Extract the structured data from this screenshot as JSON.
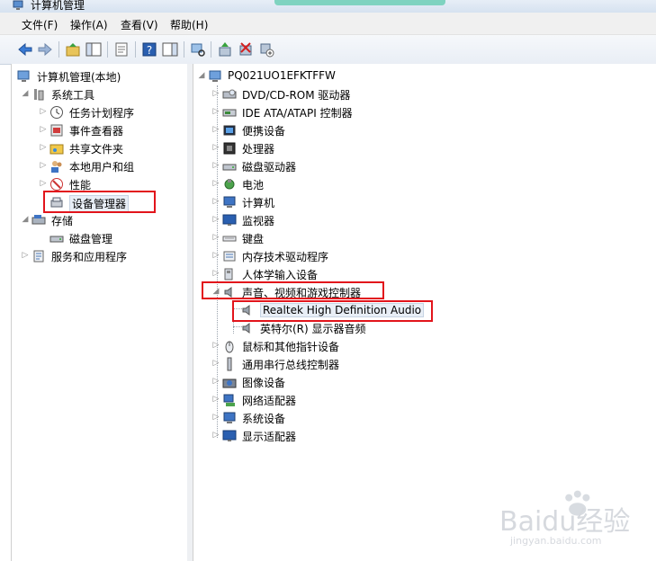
{
  "window": {
    "title": "计算机管理"
  },
  "menubar": {
    "items": [
      "文件(F)",
      "操作(A)",
      "查看(V)",
      "帮助(H)"
    ]
  },
  "toolbar": {
    "buttons": [
      "back-arrow-icon",
      "forward-arrow-icon",
      "up-folder-icon",
      "console-tree-icon",
      "properties-icon",
      "help-icon",
      "action-pane-icon",
      "scan-hardware-icon",
      "update-driver-icon",
      "uninstall-device-icon",
      "disable-device-icon"
    ]
  },
  "left_tree": {
    "root": "计算机管理(本地)",
    "system_tools": "系统工具",
    "task_scheduler": "任务计划程序",
    "event_viewer": "事件查看器",
    "shared_folders": "共享文件夹",
    "local_users": "本地用户和组",
    "performance": "性能",
    "device_manager": "设备管理器",
    "storage": "存储",
    "disk_management": "磁盘管理",
    "services_apps": "服务和应用程序"
  },
  "right_tree": {
    "computer_name": "PQ021UO1EFKTFFW",
    "categories": [
      "DVD/CD-ROM 驱动器",
      "IDE ATA/ATAPI 控制器",
      "便携设备",
      "处理器",
      "磁盘驱动器",
      "电池",
      "计算机",
      "监视器",
      "键盘",
      "内存技术驱动程序",
      "人体学输入设备",
      "声音、视频和游戏控制器",
      "鼠标和其他指针设备",
      "通用串行总线控制器",
      "图像设备",
      "网络适配器",
      "系统设备",
      "显示适配器"
    ],
    "sound_children": [
      "Realtek High Definition Audio",
      "英特尔(R) 显示器音频"
    ]
  },
  "watermark": {
    "brand": "Baidu经验",
    "url": "jingyan.baidu.com"
  },
  "colors": {
    "highlight_box": "#e2141b",
    "toolbar_bg": "#e9eef5",
    "selection": "#e8eef6"
  }
}
